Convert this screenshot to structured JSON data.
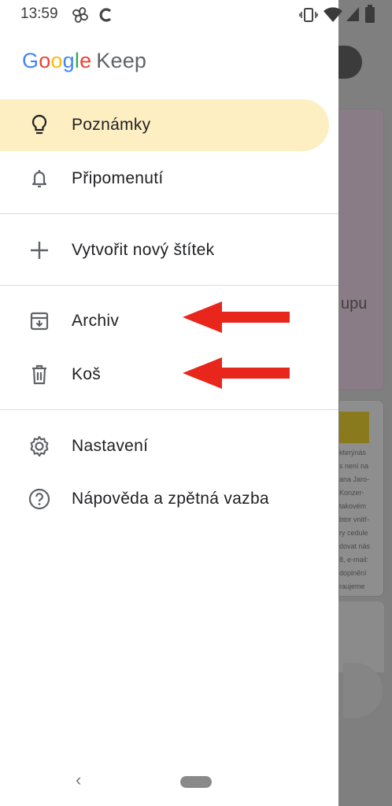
{
  "status": {
    "time": "13:59"
  },
  "logo": {
    "google": [
      "G",
      "o",
      "o",
      "g",
      "l",
      "e"
    ],
    "product": "Keep"
  },
  "menu": {
    "notes": "Poznámky",
    "reminders": "Připomenutí",
    "new_label": "Vytvořit nový štítek",
    "archive": "Archiv",
    "trash": "Koš",
    "settings": "Nastavení",
    "help": "Nápověda a zpětná vazba"
  },
  "background": {
    "pink_card_text": "upu",
    "note_lines": [
      "kterýnás",
      "s není na",
      "ana Jaro-",
      "Konzer-",
      "takovém",
      "btor vnitř-",
      "ry cedule",
      "dovat nás",
      "8, e-mail:",
      "doplnění",
      "raujeme"
    ]
  },
  "colors": {
    "active_bg": "#feefc3",
    "arrow": "#e8261c"
  },
  "icons": [
    "lightbulb-icon",
    "bell-icon",
    "plus-icon",
    "archive-icon",
    "trash-icon",
    "gear-icon",
    "help-icon"
  ]
}
